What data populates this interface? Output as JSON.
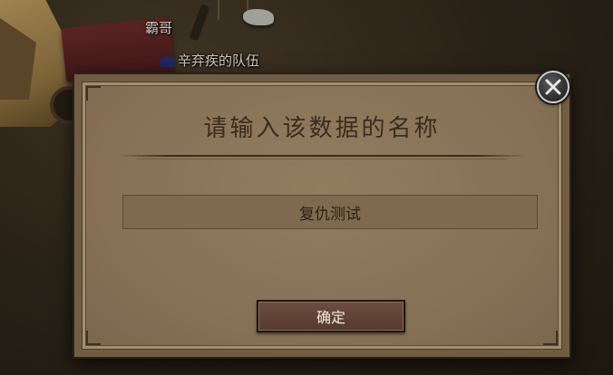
{
  "world": {
    "npc_name": "霸哥",
    "party_label": "辛弃疾的队伍"
  },
  "dialog": {
    "title": "请输入该数据的名称",
    "input_value": "复仇测试",
    "confirm_label": "确定",
    "close_icon": "close-icon"
  },
  "colors": {
    "panel": "#8c7658",
    "title_text": "#3a2d1e",
    "button": "#5f4335",
    "button_text": "#f2ece0"
  }
}
